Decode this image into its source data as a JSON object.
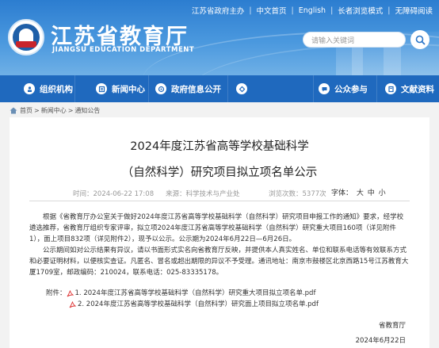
{
  "header": {
    "site_name": "江苏省教育厅",
    "site_name_en": "JIANGSU EDUCATION DEPARTMENT",
    "toplinks": [
      "江苏省政府主办",
      "中文首页",
      "English",
      "长者浏览模式",
      "无障碍阅读"
    ],
    "search_placeholder": "请输入关键词"
  },
  "nav": {
    "items": [
      {
        "label": "组织机构",
        "icon": "org-icon"
      },
      {
        "label": "新闻中心",
        "icon": "news-icon"
      },
      {
        "label": "政府信息公开",
        "icon": "info-icon"
      },
      {
        "label": "",
        "icon": "service-icon"
      },
      {
        "label": "公众参与",
        "icon": "chat-icon"
      },
      {
        "label": "文献资料",
        "icon": "book-icon"
      }
    ]
  },
  "breadcrumb": [
    "首页",
    "新闻中心",
    "通知公告"
  ],
  "article": {
    "title_line1": "2024年度江苏省高等学校基础科学",
    "title_line2": "（自然科学）研究项目拟立项名单公示",
    "date": "时间：2024-06-22 17:08",
    "source": "来源：科学技术与产业处",
    "views": "浏览次数：5377次",
    "font_size_label": "字体：",
    "font_sizes": [
      "大",
      "中",
      "小"
    ],
    "para1": "根据《省教育厅办公室关于做好2024年度江苏省高等学校基础科学（自然科学）研究项目申报工作的通知》要求，经学校遴选推荐，省教育厅组织专家评审，拟立项2024年度江苏省高等学校基础科学（自然科学）研究重大项目160项（详见附件1），面上项目832项（详见附件2），现予以公示。公示期为2024年6月22日—6月26日。",
    "para2": "公示期间如对公示结果有异议，请以书面形式实名向省教育厅反映，并提供本人真实姓名、单位和联系电话等有效联系方式和必要证明材料，以便核实查证。凡匿名、冒名或超出期限的异议不予受理。通讯地址：南京市鼓楼区北京西路15号江苏教育大厦1709室，邮政编码：210024，联系电话：025-83335178。",
    "attach_label": "附件：",
    "attachments": [
      "1. 2024年度江苏省高等学校基础科学（自然科学）研究重大项目拟立项名单.pdf",
      "2. 2024年度江苏省高等学校基础科学（自然科学）研究面上项目拟立项名单.pdf"
    ],
    "signature": "省教育厅",
    "sign_date": "2024年6月22日"
  }
}
